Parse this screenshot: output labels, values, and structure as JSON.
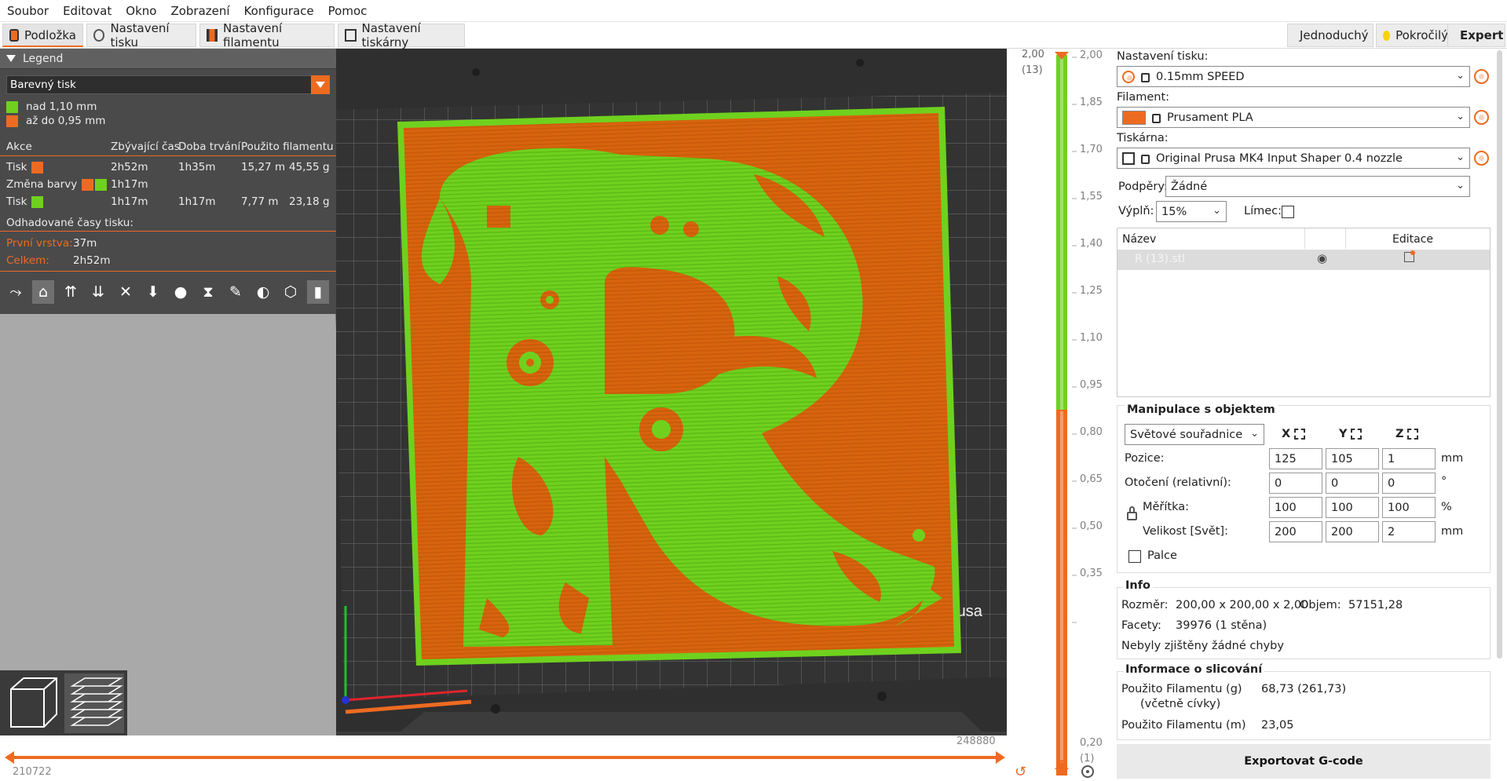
{
  "menu": [
    "Soubor",
    "Editovat",
    "Okno",
    "Zobrazení",
    "Konfigurace",
    "Pomoc"
  ],
  "tabs": [
    {
      "label": "Podložka",
      "active": true
    },
    {
      "label": "Nastavení tisku",
      "active": false
    },
    {
      "label": "Nastavení filamentu",
      "active": false
    },
    {
      "label": "Nastavení tiskárny",
      "active": false
    }
  ],
  "modes": {
    "simple": "Jednoduchý",
    "advanced": "Pokročilý",
    "expert": "Expert"
  },
  "colors": {
    "accent": "#ed6b21",
    "green": "#6fd11e",
    "yellow": "#f5d40b",
    "red": "#e6202b",
    "grey": "#4a4a4a"
  },
  "legend": {
    "title": "Legend",
    "view_type": "Barevný tisk",
    "ranges": [
      {
        "label": "nad 1,10 mm",
        "color": "#6fd11e"
      },
      {
        "label": "až do 0,95 mm",
        "color": "#ed6b21"
      }
    ],
    "columns": [
      "Akce",
      "Zbývající čas",
      "Doba trvání",
      "Použito filamentu"
    ],
    "rows": [
      {
        "action": "Tisk",
        "remaining": "2h52m",
        "duration": "1h35m",
        "length": "15,27 m",
        "weight": "45,55 g"
      },
      {
        "action": "Změna barvy",
        "remaining": "1h17m",
        "duration": "",
        "length": "",
        "weight": ""
      },
      {
        "action": "Tisk",
        "remaining": "1h17m",
        "duration": "1h17m",
        "length": "7,77 m",
        "weight": "23,18 g"
      }
    ],
    "estimated_label": "Odhadované časy tisku:",
    "first_layer_label": "První vrstva:",
    "first_layer_value": "37m",
    "total_label": "Celkem:",
    "total_value": "2h52m"
  },
  "vslider": {
    "top_value": "2,00",
    "top_layer": "(13)",
    "bottom_value": "0,20",
    "bottom_layer": "(1)",
    "ticks": [
      "2,00",
      "1,85",
      "1,70",
      "1,55",
      "1,40",
      "1,25",
      "1,10",
      "0,95",
      "0,80",
      "0,65",
      "0,50",
      "0,35",
      "0,20"
    ],
    "color_change_at": "1,10"
  },
  "hslider": {
    "left_value": "210722",
    "right_value": "248880"
  },
  "right": {
    "print_settings_label": "Nastavení tisku:",
    "print_settings_value": "0.15mm SPEED",
    "filament_label": "Filament:",
    "filament_value": "Prusament PLA",
    "printer_label": "Tiskárna:",
    "printer_value": "Original Prusa MK4 Input Shaper 0.4 nozzle",
    "supports_label": "Podpěry:",
    "supports_value": "Žádné",
    "infill_label": "Výplň:",
    "infill_value": "15%",
    "brim_label": "Límec:",
    "list_col_name": "Název",
    "list_col_edit": "Editace",
    "object_name": "R (13).stl",
    "manip_title": "Manipulace s objektem",
    "coord_system": "Světové souřadnice",
    "axes": [
      "X",
      "Y",
      "Z"
    ],
    "position_label": "Pozice:",
    "position": [
      "125",
      "105",
      "1"
    ],
    "position_unit": "mm",
    "rotation_label": "Otočení (relativní):",
    "rotation": [
      "0",
      "0",
      "0"
    ],
    "rotation_unit": "°",
    "scale_label": "Měřítka:",
    "scale": [
      "100",
      "100",
      "100"
    ],
    "scale_unit": "%",
    "size_label": "Velikost [Svět]:",
    "size": [
      "200",
      "200",
      "2"
    ],
    "size_unit": "mm",
    "inches_label": "Palce",
    "info_title": "Info",
    "size_info_label": "Rozměr:",
    "size_info_value": "200,00 x 200,00 x 2,00",
    "volume_label": "Objem:",
    "volume_value": "57151,28",
    "facets_label": "Facety:",
    "facets_value": "39976 (1 stěna)",
    "errors_text": "Nebyly zjištěny žádné chyby",
    "slice_title": "Informace o slicování",
    "fil_g_label": "Použito Filamentu (g)",
    "fil_g_sub": "(včetně cívky)",
    "fil_g_value": "68,73 (261,73)",
    "fil_m_label": "Použito Filamentu (m)",
    "fil_m_value": "23,05",
    "export_label": "Exportovat G-code"
  },
  "bed_brand": "rusa"
}
